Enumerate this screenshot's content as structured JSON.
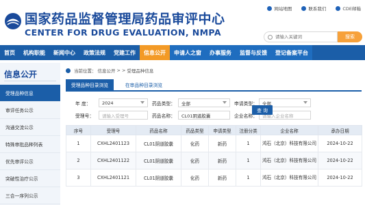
{
  "header": {
    "title_cn": "国家药品监督管理局药品审评中心",
    "title_en": "CENTER FOR DRUG EVALUATION, NMPA",
    "top_links": [
      "网站地图",
      "联系我们",
      "CDE邮箱"
    ],
    "search_placeholder": "请输入关键词",
    "search_button": "搜索",
    "colors": {
      "brand_blue": "#1a4a9b",
      "accent_orange": "#f7a13a"
    }
  },
  "nav": {
    "items": [
      "首页",
      "机构职能",
      "新闻中心",
      "政策法规",
      "党建工作",
      "信息公开",
      "申请人之窗",
      "办事服务",
      "监督与反馈",
      "登记备案平台"
    ],
    "active": "信息公开"
  },
  "sidebar": {
    "title": "信息公开",
    "items": [
      "受理品种信息",
      "审评任务公示",
      "沟通交流公示",
      "特殊审批品种列表",
      "优先审评公示",
      "突破性治疗公示",
      "三合一序列公示"
    ],
    "active": "受理品种信息"
  },
  "breadcrumb": {
    "prefix": "当前位置：",
    "parts": [
      "信息公开",
      ">",
      ">",
      "受理品种信息"
    ]
  },
  "tabs": [
    "受理品种目录浏览",
    "在审品种目录浏览"
  ],
  "filter": {
    "year_label": "年  度：",
    "year_value": "2024",
    "drug_type_label": "药品类型：",
    "drug_type_value": "全部",
    "apply_type_label": "申请类型：",
    "apply_type_value": "全部",
    "accept_no_label": "受理号：",
    "accept_no_placeholder": "请输入受理号",
    "drug_name_label": "药品名称：",
    "drug_name_value": "CL01阴道胶囊",
    "company_label": "企业名称：",
    "company_placeholder": "请输入企业名称",
    "query_button": "查 询"
  },
  "table": {
    "columns": [
      "序号",
      "受理号",
      "药品名称",
      "药品类型",
      "申请类型",
      "注册分类",
      "企业名称",
      "承办日期"
    ],
    "rows": [
      [
        "1",
        "CXHL2401123",
        "CL01阴道胶囊",
        "化药",
        "新药",
        "1",
        "鸿石（北京）科技有限公司",
        "2024-10-22"
      ],
      [
        "2",
        "CXHL2401122",
        "CL01阴道胶囊",
        "化药",
        "新药",
        "1",
        "鸿石（北京）科技有限公司",
        "2024-10-22"
      ],
      [
        "3",
        "CXHL2401121",
        "CL01阴道胶囊",
        "化药",
        "新药",
        "1",
        "鸿石（北京）科技有限公司",
        "2024-10-22"
      ]
    ]
  }
}
